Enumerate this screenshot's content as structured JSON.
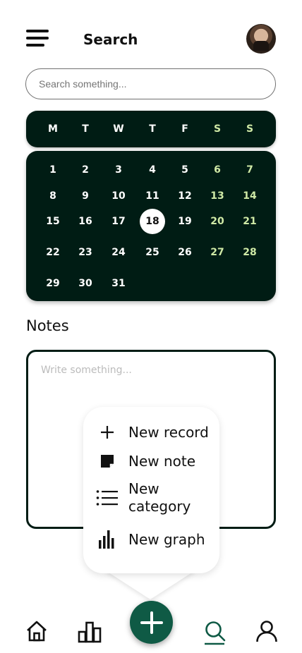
{
  "header": {
    "title": "Search",
    "menu_icon": "hamburger-menu-icon",
    "avatar": "user-avatar"
  },
  "search": {
    "placeholder": "Search something..."
  },
  "calendar": {
    "weekdays": [
      "M",
      "T",
      "W",
      "T",
      "F",
      "S",
      "S"
    ],
    "weeks": [
      [
        "1",
        "2",
        "3",
        "4",
        "5",
        "6",
        "7"
      ],
      [
        "8",
        "9",
        "10",
        "11",
        "12",
        "13",
        "14"
      ],
      [
        "15",
        "16",
        "17",
        "18",
        "19",
        "20",
        "21"
      ],
      [
        "22",
        "23",
        "24",
        "25",
        "26",
        "27",
        "28"
      ],
      [
        "29",
        "30",
        "31",
        "",
        "",
        "",
        ""
      ]
    ],
    "selected_day": "18",
    "weekend_color": "#cfe9a6",
    "background_color": "#001c14"
  },
  "notes": {
    "label": "Notes",
    "placeholder": "Write something..."
  },
  "popup_menu": {
    "items": [
      {
        "label": "New record",
        "icon": "plus-icon"
      },
      {
        "label": "New note",
        "icon": "note-icon"
      },
      {
        "label": "New\ncategory",
        "icon": "list-icon"
      },
      {
        "label": "New graph",
        "icon": "bar-chart-icon"
      }
    ]
  },
  "bottom_nav": {
    "items": [
      "home-icon",
      "stats-icon",
      "add-fab",
      "search-icon",
      "profile-icon"
    ],
    "active": "search-icon",
    "fab_color": "#0f5a45"
  }
}
